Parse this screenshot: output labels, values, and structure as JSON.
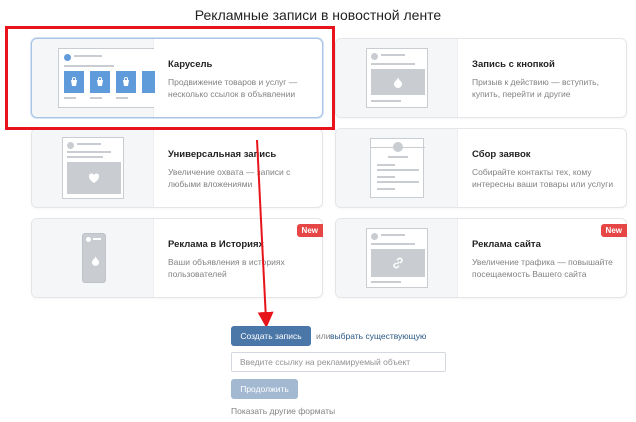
{
  "page": {
    "title": "Рекламные записи в новостной ленте"
  },
  "formats": [
    {
      "title": "Карусель",
      "description": "Продвижение товаров и услуг — несколько ссылок в объявлении",
      "selected": true,
      "badge": "",
      "icon": "carousel-preview"
    },
    {
      "title": "Запись с кнопкой",
      "description": "Призыв к действию — вступить, купить, перейти и другие",
      "selected": false,
      "badge": "",
      "icon": "button-post-preview"
    },
    {
      "title": "Универсальная запись",
      "description": "Увеличение охвата — записи с любыми вложениями",
      "selected": false,
      "badge": "",
      "icon": "universal-post-preview"
    },
    {
      "title": "Сбор заявок",
      "description": "Собирайте контакты тех, кому интересны ваши товары или услуги",
      "selected": false,
      "badge": "",
      "icon": "lead-form-preview"
    },
    {
      "title": "Реклама в Историях",
      "description": "Ваши объявления в историях пользователей",
      "selected": false,
      "badge": "New",
      "icon": "stories-preview"
    },
    {
      "title": "Реклама сайта",
      "description": "Увеличение трафика — повышайте посещаемость Вашего сайта",
      "selected": false,
      "badge": "New",
      "icon": "site-ad-preview"
    }
  ],
  "actions": {
    "create_label": "Создать запись",
    "or_text": "или",
    "choose_existing_label": "выбрать существующую",
    "url_placeholder": "Введите ссылку на рекламируемый объект",
    "url_value": "",
    "continue_label": "Продолжить",
    "other_formats_label": "Показать другие форматы"
  },
  "annotations": {
    "highlight_color": "#e8141b"
  },
  "colors": {
    "accent": "#4a76a8",
    "accent_disabled": "#a3b8d1",
    "badge": "#e64646",
    "link": "#2a5885",
    "placeholder_blue": "#5f9bdb"
  }
}
